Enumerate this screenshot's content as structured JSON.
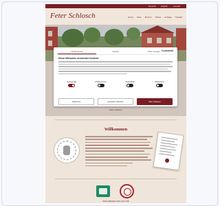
{
  "header": {
    "top_links": [
      "Deutsch",
      "English",
      "Kontakt"
    ],
    "logo": "Feter Schlosch",
    "menu": [
      "Home",
      "Über",
      "Zimmer",
      "Preise",
      "Anfrage",
      "Kontakt"
    ]
  },
  "consent": {
    "tabs": [
      "Zustimmung",
      "Details",
      "Über Cookies"
    ],
    "brand": "Cookiebot",
    "heading": "Diese Webseite verwendet Cookies",
    "categories": [
      {
        "label": "Notwendig",
        "on": true
      },
      {
        "label": "Präferenzen",
        "on": false
      },
      {
        "label": "Statistiken",
        "on": false
      },
      {
        "label": "Marketing",
        "on": false
      }
    ],
    "buttons": [
      "Ablehnen",
      "Auswahl erlauben",
      "Alle zulassen"
    ]
  },
  "more_link": "Mehr erfahren",
  "about": {
    "title": "Willkommen"
  },
  "badges": {
    "caption": "WIR FREUEN UNS AUF SIE"
  },
  "colors": {
    "brand": "#7a1d23",
    "page_bg": "#efe5db",
    "badge_green": "#1f8a64"
  }
}
